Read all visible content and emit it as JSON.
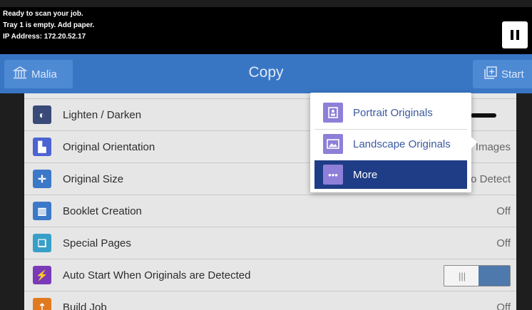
{
  "status": {
    "lines": [
      "Ready to scan your job.",
      "Tray 1 is empty.  Add paper.",
      "IP Address: 172.20.52.17"
    ],
    "pause_icon": "pause-icon"
  },
  "header": {
    "home_label": "Malia",
    "title": "Copy",
    "start_label": "Start"
  },
  "settings": [
    {
      "label": "Lighten / Darken",
      "value": "",
      "color": "#3a4a78",
      "icon": "contrast-icon"
    },
    {
      "label": "Original Orientation",
      "value": "Images",
      "color": "#4c63d2",
      "icon": "orientation-icon"
    },
    {
      "label": "Original Size",
      "value": "o Detect",
      "color": "#3c78c8",
      "icon": "size-icon"
    },
    {
      "label": "Booklet Creation",
      "value": "Off",
      "color": "#3c78c8",
      "icon": "booklet-icon"
    },
    {
      "label": "Special Pages",
      "value": "Off",
      "color": "#38a0c8",
      "icon": "pages-icon"
    },
    {
      "label": "Auto Start When Originals are Detected",
      "value": "",
      "color": "#7a3ab8",
      "icon": "auto-start-icon"
    },
    {
      "label": "Build Job",
      "value": "Off",
      "color": "#e07a20",
      "icon": "build-job-icon"
    }
  ],
  "popup": {
    "items": [
      {
        "label": "Portrait Originals",
        "icon": "portrait-icon"
      },
      {
        "label": "Landscape Originals",
        "icon": "landscape-icon"
      },
      {
        "label": "More",
        "icon": "more-icon",
        "selected": true
      }
    ]
  }
}
